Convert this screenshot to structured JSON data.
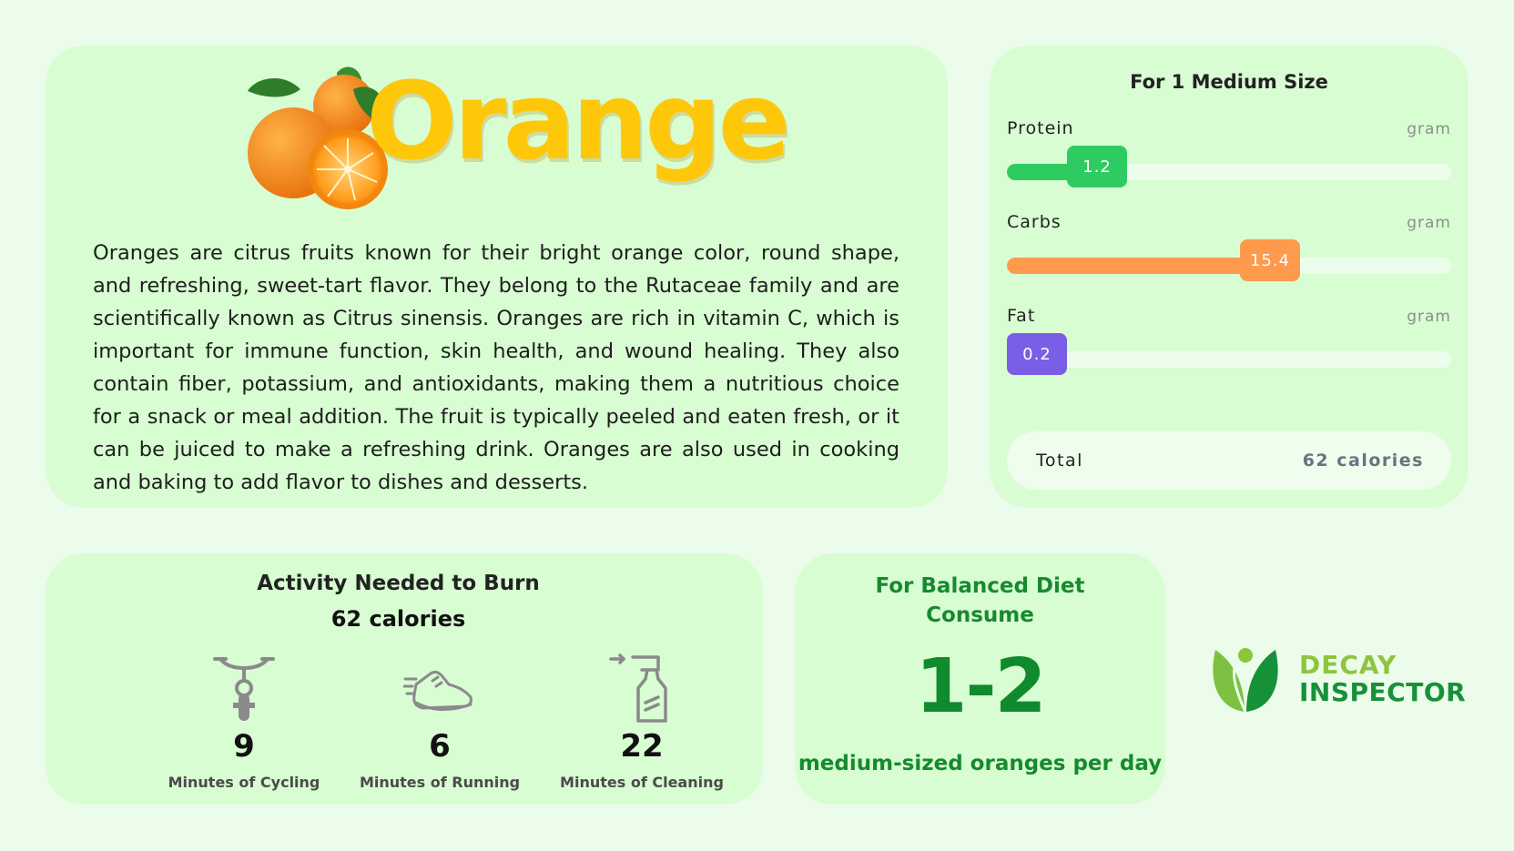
{
  "intro": {
    "title": "Orange",
    "description": "Oranges are citrus fruits known for their bright orange color, round shape, and refreshing, sweet-tart flavor. They belong to the Rutaceae family and are scientifically known as Citrus sinensis. Oranges are rich in vitamin C, which is important for immune function, skin health, and wound healing. They also contain fiber, potassium, and antioxidants, making them a nutritious choice for a snack or meal addition. The fruit is typically peeled and eaten fresh, or it can be juiced to make a refreshing drink. Oranges are also used in cooking and baking to add flavor to dishes and desserts."
  },
  "nutrition": {
    "title": "For 1 Medium Size",
    "items": [
      {
        "name": "Protein",
        "unit": "gram",
        "value": "1.2",
        "fraction": 0.27,
        "color": "#2ecc60"
      },
      {
        "name": "Carbs",
        "unit": "gram",
        "value": "15.4",
        "fraction": 0.66,
        "color": "#ff9a4d"
      },
      {
        "name": "Fat",
        "unit": "gram",
        "value": "0.2",
        "fraction": 0.09,
        "color": "#7a5ee6"
      }
    ],
    "total_label": "Total",
    "total_value": "62 calories"
  },
  "activity": {
    "title": "Activity Needed to Burn",
    "subtitle": "62 calories",
    "items": [
      {
        "icon": "bicycle-icon",
        "value": "9",
        "label": "Minutes of Cycling"
      },
      {
        "icon": "running-shoe-icon",
        "value": "6",
        "label": "Minutes of Running"
      },
      {
        "icon": "spray-bottle-icon",
        "value": "22",
        "label": "Minutes of Cleaning"
      }
    ]
  },
  "diet": {
    "title_line1": "For Balanced Diet",
    "title_line2": "Consume",
    "amount": "1-2",
    "subtitle": "medium-sized oranges per day"
  },
  "logo": {
    "line1": "DECAY",
    "line2": "INSPECTOR"
  },
  "colors": {
    "background": "#ecfceb",
    "card": "#d8fdd2",
    "title_yellow": "#ffc70a",
    "diet_green": "#0f8a2c"
  }
}
